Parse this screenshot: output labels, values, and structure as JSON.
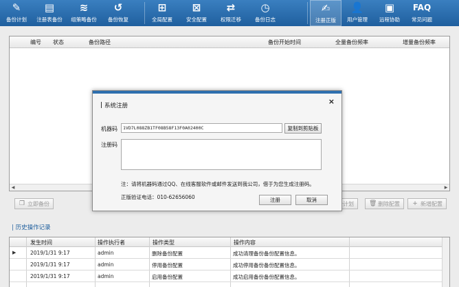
{
  "toolbar": {
    "items": [
      {
        "label": "备份计划",
        "icon": "edit-doc-icon"
      },
      {
        "label": "注册表备份",
        "icon": "document-icon"
      },
      {
        "label": "组策略备份",
        "icon": "layers-icon"
      },
      {
        "label": "备份恢复",
        "icon": "restore-icon"
      },
      {
        "label": "全局配置",
        "icon": "grid-icon"
      },
      {
        "label": "安全配置",
        "icon": "security-doc-icon"
      },
      {
        "label": "权限迁移",
        "icon": "migrate-icon"
      },
      {
        "label": "备份日志",
        "icon": "log-icon"
      },
      {
        "label": "注册正版",
        "icon": "register-icon"
      },
      {
        "label": "用户管理",
        "icon": "user-icon"
      },
      {
        "label": "远程协助",
        "icon": "remote-icon"
      },
      {
        "label": "常见问题",
        "icon": "faq-icon"
      }
    ]
  },
  "plan_table": {
    "columns": [
      "编号",
      "状态",
      "备份路径",
      "备份开始时间",
      "全量备份频率",
      "增量备份频率"
    ]
  },
  "actions": {
    "immediate": "立即备份",
    "plan_partial": "份计划",
    "delete_config": "删除配置",
    "add_config": "新增配置"
  },
  "history": {
    "title": "历史操作记录",
    "columns": [
      "发生时间",
      "操作执行者",
      "操作类型",
      "操作内容"
    ],
    "rows": [
      {
        "time": "2019/1/31 9:17",
        "user": "admin",
        "type": "删除备份配置",
        "content": "成功清理备份备份配置信息。",
        "current": true
      },
      {
        "time": "2019/1/31 9:17",
        "user": "admin",
        "type": "停用备份配置",
        "content": "成功停用备份备份配置信息。",
        "current": false
      },
      {
        "time": "2019/1/31 9:17",
        "user": "admin",
        "type": "启用备份配置",
        "content": "成功启用备份备份配置信息。",
        "current": false
      }
    ]
  },
  "dialog": {
    "title": "系统注册",
    "close": "×",
    "machine_code_label": "机器码",
    "machine_code": "1VD7L088ZB1TF08B58F13F0A02400C",
    "copy_button": "复制到剪贴板",
    "reg_code_label": "注册码",
    "reg_code": "",
    "note": "注：请将机器码通过QQ、在线客服软件或邮件发送到我公司，借于为您生成注册码。",
    "phone": "正版验证电话：010-62656060",
    "register_button": "注册",
    "cancel_button": "取消"
  },
  "colors": {
    "toolbar": "#2a6dad",
    "dialog_accent": "#2e6fae"
  }
}
